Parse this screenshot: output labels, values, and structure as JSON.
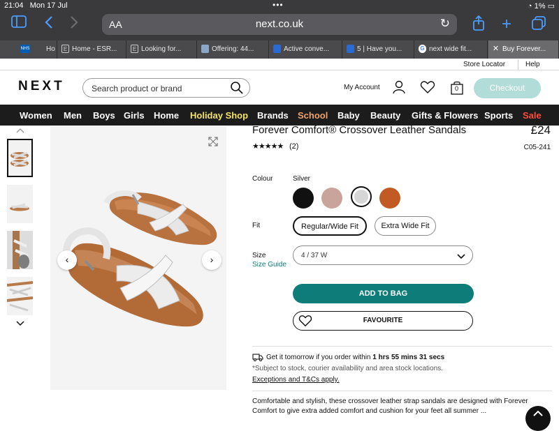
{
  "status": {
    "time": "21:04",
    "date": "Mon 17 Jul",
    "battery": "1%"
  },
  "browser": {
    "aa_label": "AA",
    "url": "next.co.uk",
    "tabs": [
      {
        "icon": "NHS",
        "title": "Ho"
      },
      {
        "icon": "E",
        "title": "Home - ESR..."
      },
      {
        "icon": "E",
        "title": "Looking for..."
      },
      {
        "icon": "",
        "title": "Offering: 44..."
      },
      {
        "icon": "",
        "title": "Active conve..."
      },
      {
        "icon": "",
        "title": "5 | Have you..."
      },
      {
        "icon": "G",
        "title": "next wide fit..."
      },
      {
        "icon": "",
        "title": "Buy Forever..."
      }
    ]
  },
  "utility": {
    "store_locator": "Store Locator",
    "help": "Help"
  },
  "header": {
    "logo": "NEXT",
    "search_placeholder": "Search product or brand",
    "my_account": "My Account",
    "bag_count": "0",
    "checkout": "Checkout"
  },
  "nav": {
    "items": [
      {
        "label": "Women",
        "color": "#ffffff"
      },
      {
        "label": "Men",
        "color": "#ffffff"
      },
      {
        "label": "Boys",
        "color": "#ffffff"
      },
      {
        "label": "Girls",
        "color": "#ffffff"
      },
      {
        "label": "Home",
        "color": "#ffffff"
      },
      {
        "label": "Holiday Shop",
        "color": "#f3e36b"
      },
      {
        "label": "Brands",
        "color": "#ffffff"
      },
      {
        "label": "School",
        "color": "#f0a36c"
      },
      {
        "label": "Baby",
        "color": "#ffffff"
      },
      {
        "label": "Beauty",
        "color": "#ffffff"
      },
      {
        "label": "Gifts & Flowers",
        "color": "#ffffff"
      },
      {
        "label": "Sports",
        "color": "#ffffff"
      },
      {
        "label": "Sale",
        "color": "#ff4a3a"
      }
    ]
  },
  "product": {
    "title": "Forever Comfort® Crossover Leather Sandals",
    "price": "£24",
    "stars": "★★★★★",
    "rating_value": 5,
    "review_count": "(2)",
    "code": "C05-241",
    "colour_label": "Colour",
    "selected_colour": "Silver",
    "swatches": [
      {
        "name": "black",
        "color": "#111111"
      },
      {
        "name": "rose-gold",
        "color": "#c9a49a"
      },
      {
        "name": "silver",
        "color": "#d6d6d6"
      },
      {
        "name": "tan",
        "color": "#c25a23"
      }
    ],
    "fit_label": "Fit",
    "fit_options": [
      "Regular/Wide Fit",
      "Extra Wide Fit"
    ],
    "size_label": "Size",
    "size_guide": "Size Guide",
    "size_value": "4 / 37 W",
    "add_to_bag": "ADD TO BAG",
    "favourite": "FAVOURITE",
    "delivery_prefix": "Get it tomorrow if you order within",
    "delivery_time": "1 hrs 55 mins 31 secs",
    "subject_note": "*Subject to stock, courier availability and area stock locations.",
    "terms_link": "Exceptions and T&Cs apply.",
    "description": "Comfortable and stylish, these crossover leather strap sandals are designed with Forever Comfort to give extra added comfort and cushion for your feet all summer ..."
  },
  "colors": {
    "accent": "#0e7c79",
    "checkout_disabled": "#b1dcd8",
    "nav_bg": "#1c1c1c"
  }
}
